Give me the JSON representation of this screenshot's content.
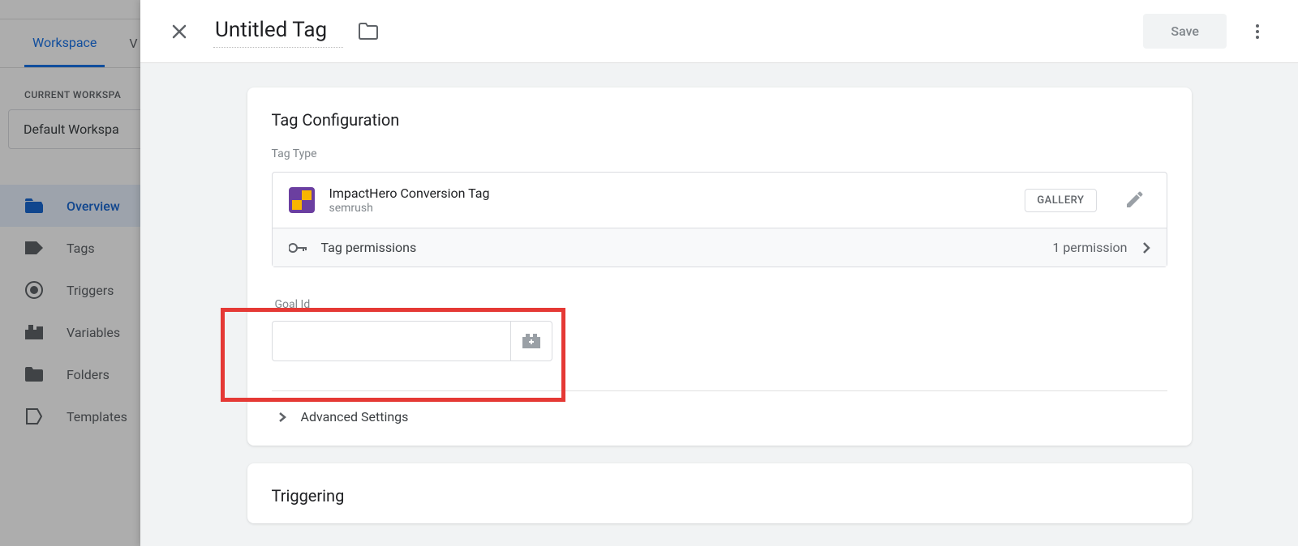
{
  "bg": {
    "tab_workspace": "Workspace",
    "tab_partial": "V",
    "ws_label": "CURRENT WORKSPA",
    "ws_name": "Default Workspa",
    "nav": {
      "overview": "Overview",
      "tags": "Tags",
      "triggers": "Triggers",
      "variables": "Variables",
      "folders": "Folders",
      "templates": "Templates"
    }
  },
  "header": {
    "title": "Untitled Tag",
    "save": "Save"
  },
  "config": {
    "card_title": "Tag Configuration",
    "tag_type_label": "Tag Type",
    "tag_name": "ImpactHero Conversion Tag",
    "tag_vendor": "semrush",
    "gallery": "GALLERY",
    "permissions_label": "Tag permissions",
    "permissions_count": "1 permission",
    "goal_label": "Goal Id",
    "advanced": "Advanced Settings"
  },
  "triggering": {
    "card_title": "Triggering"
  }
}
